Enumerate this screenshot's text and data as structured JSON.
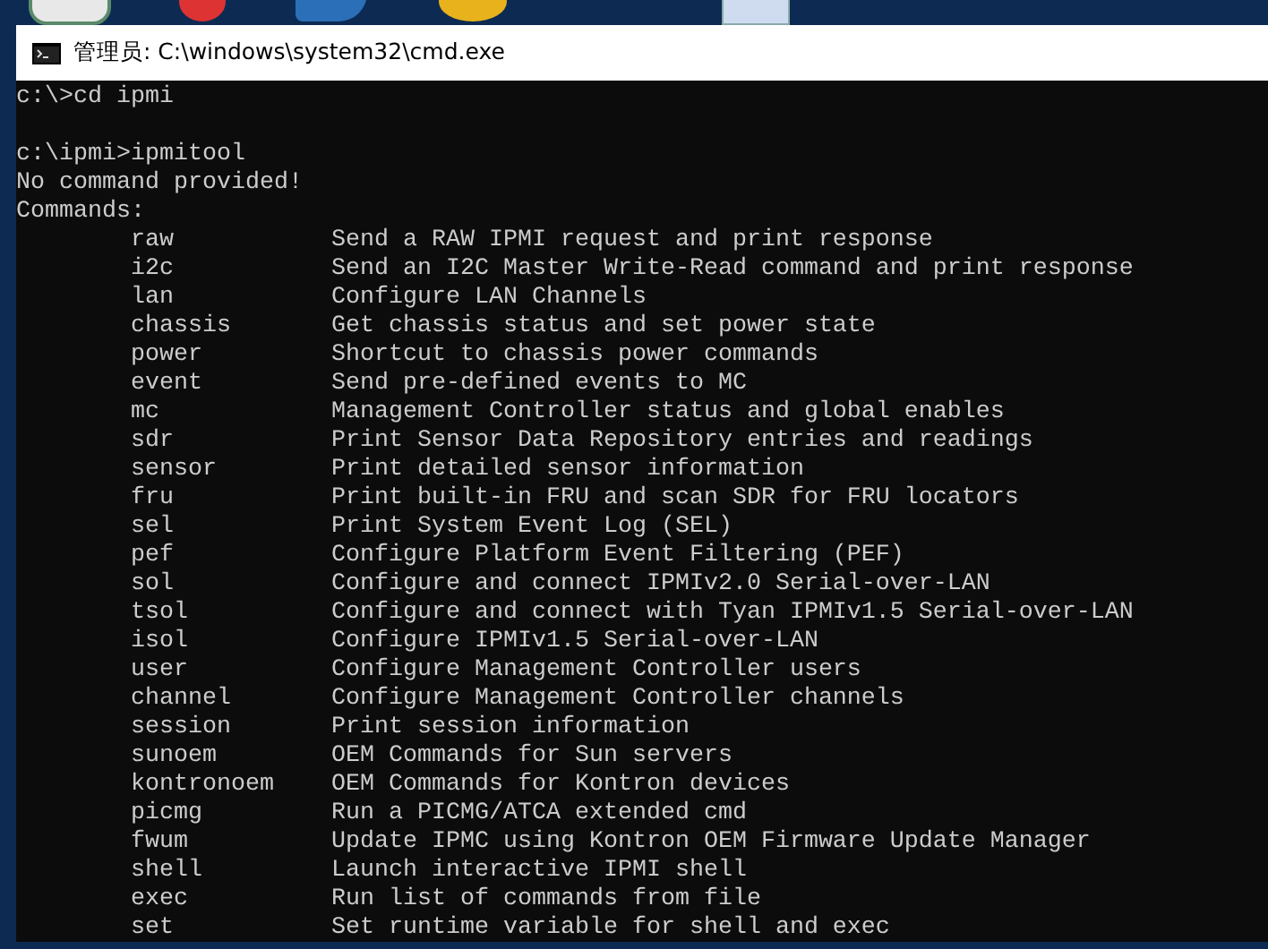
{
  "window": {
    "title": "管理员: C:\\windows\\system32\\cmd.exe"
  },
  "console": {
    "lines": [
      {
        "kind": "prompt",
        "text": "c:\\>cd ipmi"
      },
      {
        "kind": "prompt",
        "text": "c:\\ipmi>ipmitool"
      },
      {
        "kind": "output",
        "text": "No command provided!"
      },
      {
        "kind": "output",
        "text": "Commands:"
      }
    ],
    "commands": [
      {
        "name": "raw",
        "description": "Send a RAW IPMI request and print response"
      },
      {
        "name": "i2c",
        "description": "Send an I2C Master Write-Read command and print response"
      },
      {
        "name": "lan",
        "description": "Configure LAN Channels"
      },
      {
        "name": "chassis",
        "description": "Get chassis status and set power state"
      },
      {
        "name": "power",
        "description": "Shortcut to chassis power commands"
      },
      {
        "name": "event",
        "description": "Send pre-defined events to MC"
      },
      {
        "name": "mc",
        "description": "Management Controller status and global enables"
      },
      {
        "name": "sdr",
        "description": "Print Sensor Data Repository entries and readings"
      },
      {
        "name": "sensor",
        "description": "Print detailed sensor information"
      },
      {
        "name": "fru",
        "description": "Print built-in FRU and scan SDR for FRU locators"
      },
      {
        "name": "sel",
        "description": "Print System Event Log (SEL)"
      },
      {
        "name": "pef",
        "description": "Configure Platform Event Filtering (PEF)"
      },
      {
        "name": "sol",
        "description": "Configure and connect IPMIv2.0 Serial-over-LAN"
      },
      {
        "name": "tsol",
        "description": "Configure and connect with Tyan IPMIv1.5 Serial-over-LAN"
      },
      {
        "name": "isol",
        "description": "Configure IPMIv1.5 Serial-over-LAN"
      },
      {
        "name": "user",
        "description": "Configure Management Controller users"
      },
      {
        "name": "channel",
        "description": "Configure Management Controller channels"
      },
      {
        "name": "session",
        "description": "Print session information"
      },
      {
        "name": "sunoem",
        "description": "OEM Commands for Sun servers"
      },
      {
        "name": "kontronoem",
        "description": "OEM Commands for Kontron devices"
      },
      {
        "name": "picmg",
        "description": "Run a PICMG/ATCA extended cmd"
      },
      {
        "name": "fwum",
        "description": "Update IPMC using Kontron OEM Firmware Update Manager"
      },
      {
        "name": "shell",
        "description": "Launch interactive IPMI shell"
      },
      {
        "name": "exec",
        "description": "Run list of commands from file"
      },
      {
        "name": "set",
        "description": "Set runtime variable for shell and exec"
      }
    ]
  }
}
